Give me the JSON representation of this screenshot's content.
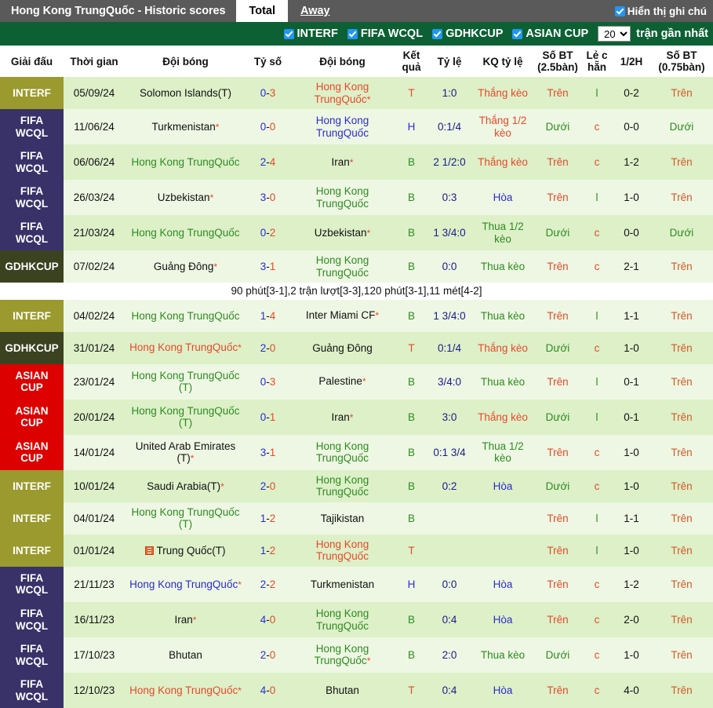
{
  "topbar": {
    "title": "Hong Kong TrungQuốc - Historic scores",
    "tab_total": "Total",
    "tab_away": "Away",
    "show_notes_label": "Hiển thị ghi chú"
  },
  "filterbar": {
    "filters": [
      {
        "label": "INTERF",
        "checked": true
      },
      {
        "label": "FIFA WCQL",
        "checked": true
      },
      {
        "label": "GDHKCUP",
        "checked": true
      },
      {
        "label": "ASIAN CUP",
        "checked": true
      }
    ],
    "count_value": "20",
    "count_options": [
      "10",
      "20",
      "30",
      "50"
    ],
    "tail_label": "trận gần nhất"
  },
  "table": {
    "headers": [
      "Giải đấu",
      "Thời gian",
      "Đội bóng",
      "Tỷ số",
      "Đội bóng",
      "Kết quả",
      "Tỷ lệ",
      "KQ tỷ lệ",
      "Số BT (2.5bàn)",
      "Lẻ c hẵn",
      "1/2H",
      "Số BT (0.75bàn)"
    ],
    "league_colors": {
      "INTERF": "#9a9a2e",
      "FIFA WCQL": "#383269",
      "GDHKCUP": "#3b4220",
      "ASIAN CUP": "#dd0000"
    },
    "rows": [
      {
        "league": "INTERF",
        "time": "05/09/24",
        "home": "Solomon Islands(T)",
        "home_color": "#111111",
        "home_star": false,
        "score": "0-3",
        "score_home": "0",
        "score_away": "3",
        "away": "Hong Kong TrungQuốc",
        "away_color": "#e8492b",
        "away_star": true,
        "result": "T",
        "result_color": "#e8492b",
        "odds": "1:0",
        "odds_result": "Thắng kèo",
        "odds_result_color": "#e8492b",
        "ou": "Trên",
        "ou_color": "#e8492b",
        "oe": "l",
        "oe_color": "#2e8b22",
        "ht": "0-2",
        "ou2": "Trên",
        "ou2_color": "#d4592a",
        "note": null
      },
      {
        "league": "FIFA WCQL",
        "time": "11/06/24",
        "home": "Turkmenistan",
        "home_color": "#111111",
        "home_star": true,
        "score": "0-0",
        "score_home": "0",
        "score_away": "0",
        "away": "Hong Kong TrungQuốc",
        "away_color": "#2b2bd4",
        "away_star": false,
        "result": "H",
        "result_color": "#2b2bd4",
        "odds": "0:1/4",
        "odds_result": "Thắng 1/2 kèo",
        "odds_result_color": "#e8492b",
        "ou": "Dưới",
        "ou_color": "#2e8b22",
        "oe": "c",
        "oe_color": "#e8492b",
        "ht": "0-0",
        "ou2": "Dưới",
        "ou2_color": "#2e8b22",
        "note": null
      },
      {
        "league": "FIFA WCQL",
        "time": "06/06/24",
        "home": "Hong Kong TrungQuốc",
        "home_color": "#2e8b22",
        "home_star": false,
        "score": "2-4",
        "score_home": "2",
        "score_away": "4",
        "away": "Iran",
        "away_color": "#111111",
        "away_star": true,
        "result": "B",
        "result_color": "#2e8b22",
        "odds": "2 1/2:0",
        "odds_result": "Thắng kèo",
        "odds_result_color": "#e8492b",
        "ou": "Trên",
        "ou_color": "#e8492b",
        "oe": "c",
        "oe_color": "#e8492b",
        "ht": "1-2",
        "ou2": "Trên",
        "ou2_color": "#d4592a",
        "note": null
      },
      {
        "league": "FIFA WCQL",
        "time": "26/03/24",
        "home": "Uzbekistan",
        "home_color": "#111111",
        "home_star": true,
        "score": "3-0",
        "score_home": "3",
        "score_away": "0",
        "away": "Hong Kong TrungQuốc",
        "away_color": "#2e8b22",
        "away_star": false,
        "result": "B",
        "result_color": "#2e8b22",
        "odds": "0:3",
        "odds_result": "Hòa",
        "odds_result_color": "#2b2bd4",
        "ou": "Trên",
        "ou_color": "#e8492b",
        "oe": "l",
        "oe_color": "#2e8b22",
        "ht": "1-0",
        "ou2": "Trên",
        "ou2_color": "#d4592a",
        "note": null
      },
      {
        "league": "FIFA WCQL",
        "time": "21/03/24",
        "home": "Hong Kong TrungQuốc",
        "home_color": "#2e8b22",
        "home_star": false,
        "score": "0-2",
        "score_home": "0",
        "score_away": "2",
        "away": "Uzbekistan",
        "away_color": "#111111",
        "away_star": true,
        "result": "B",
        "result_color": "#2e8b22",
        "odds": "1 3/4:0",
        "odds_result": "Thua 1/2 kèo",
        "odds_result_color": "#2e8b22",
        "ou": "Dưới",
        "ou_color": "#2e8b22",
        "oe": "c",
        "oe_color": "#e8492b",
        "ht": "0-0",
        "ou2": "Dưới",
        "ou2_color": "#2e8b22",
        "note": null
      },
      {
        "league": "GDHKCUP",
        "time": "07/02/24",
        "home": "Guảng Đông",
        "home_color": "#111111",
        "home_star": true,
        "score": "3-1",
        "score_home": "3",
        "score_away": "1",
        "away": "Hong Kong TrungQuốc",
        "away_color": "#2e8b22",
        "away_star": false,
        "result": "B",
        "result_color": "#2e8b22",
        "odds": "0:0",
        "odds_result": "Thua kèo",
        "odds_result_color": "#2e8b22",
        "ou": "Trên",
        "ou_color": "#e8492b",
        "oe": "c",
        "oe_color": "#e8492b",
        "ht": "2-1",
        "ou2": "Trên",
        "ou2_color": "#d4592a",
        "note": "90 phút[3-1],2 trận lượt[3-3],120 phút[3-1],11 mét[4-2]"
      },
      {
        "league": "INTERF",
        "time": "04/02/24",
        "home": "Hong Kong TrungQuốc",
        "home_color": "#2e8b22",
        "home_star": false,
        "score": "1-4",
        "score_home": "1",
        "score_away": "4",
        "away": "Inter Miami CF",
        "away_color": "#111111",
        "away_star": true,
        "result": "B",
        "result_color": "#2e8b22",
        "odds": "1 3/4:0",
        "odds_result": "Thua kèo",
        "odds_result_color": "#2e8b22",
        "ou": "Trên",
        "ou_color": "#e8492b",
        "oe": "l",
        "oe_color": "#2e8b22",
        "ht": "1-1",
        "ou2": "Trên",
        "ou2_color": "#d4592a",
        "note": null
      },
      {
        "league": "GDHKCUP",
        "time": "31/01/24",
        "home": "Hong Kong TrungQuốc",
        "home_color": "#e8492b",
        "home_star": true,
        "score": "2-0",
        "score_home": "2",
        "score_away": "0",
        "away": "Guảng Đông",
        "away_color": "#111111",
        "away_star": false,
        "result": "T",
        "result_color": "#e8492b",
        "odds": "0:1/4",
        "odds_result": "Thắng kèo",
        "odds_result_color": "#e8492b",
        "ou": "Dưới",
        "ou_color": "#2e8b22",
        "oe": "c",
        "oe_color": "#e8492b",
        "ht": "1-0",
        "ou2": "Trên",
        "ou2_color": "#d4592a",
        "note": null
      },
      {
        "league": "ASIAN CUP",
        "time": "23/01/24",
        "home": "Hong Kong TrungQuốc (T)",
        "home_color": "#2e8b22",
        "home_star": false,
        "score": "0-3",
        "score_home": "0",
        "score_away": "3",
        "away": "Palestine",
        "away_color": "#111111",
        "away_star": true,
        "result": "B",
        "result_color": "#2e8b22",
        "odds": "3/4:0",
        "odds_result": "Thua kèo",
        "odds_result_color": "#2e8b22",
        "ou": "Trên",
        "ou_color": "#e8492b",
        "oe": "l",
        "oe_color": "#2e8b22",
        "ht": "0-1",
        "ou2": "Trên",
        "ou2_color": "#d4592a",
        "note": null
      },
      {
        "league": "ASIAN CUP",
        "time": "20/01/24",
        "home": "Hong Kong TrungQuốc (T)",
        "home_color": "#2e8b22",
        "home_star": false,
        "score": "0-1",
        "score_home": "0",
        "score_away": "1",
        "away": "Iran",
        "away_color": "#111111",
        "away_star": true,
        "result": "B",
        "result_color": "#2e8b22",
        "odds": "3:0",
        "odds_result": "Thắng kèo",
        "odds_result_color": "#e8492b",
        "ou": "Dưới",
        "ou_color": "#2e8b22",
        "oe": "l",
        "oe_color": "#2e8b22",
        "ht": "0-1",
        "ou2": "Trên",
        "ou2_color": "#d4592a",
        "note": null
      },
      {
        "league": "ASIAN CUP",
        "time": "14/01/24",
        "home": "United Arab Emirates (T)",
        "home_color": "#111111",
        "home_star": true,
        "score": "3-1",
        "score_home": "3",
        "score_away": "1",
        "away": "Hong Kong TrungQuốc",
        "away_color": "#2e8b22",
        "away_star": false,
        "result": "B",
        "result_color": "#2e8b22",
        "odds": "0:1 3/4",
        "odds_result": "Thua 1/2 kèo",
        "odds_result_color": "#2e8b22",
        "ou": "Trên",
        "ou_color": "#e8492b",
        "oe": "c",
        "oe_color": "#e8492b",
        "ht": "1-0",
        "ou2": "Trên",
        "ou2_color": "#d4592a",
        "note": null
      },
      {
        "league": "INTERF",
        "time": "10/01/24",
        "home": "Saudi Arabia(T)",
        "home_color": "#111111",
        "home_star": true,
        "score": "2-0",
        "score_home": "2",
        "score_away": "0",
        "away": "Hong Kong TrungQuốc",
        "away_color": "#2e8b22",
        "away_star": false,
        "result": "B",
        "result_color": "#2e8b22",
        "odds": "0:2",
        "odds_result": "Hòa",
        "odds_result_color": "#2b2bd4",
        "ou": "Dưới",
        "ou_color": "#2e8b22",
        "oe": "c",
        "oe_color": "#e8492b",
        "ht": "1-0",
        "ou2": "Trên",
        "ou2_color": "#d4592a",
        "note": null
      },
      {
        "league": "INTERF",
        "time": "04/01/24",
        "home": "Hong Kong TrungQuốc (T)",
        "home_color": "#2e8b22",
        "home_star": false,
        "score": "1-2",
        "score_home": "1",
        "score_away": "2",
        "away": "Tajikistan",
        "away_color": "#111111",
        "away_star": false,
        "result": "B",
        "result_color": "#2e8b22",
        "odds": "",
        "odds_result": "",
        "odds_result_color": "#111111",
        "ou": "Trên",
        "ou_color": "#e8492b",
        "oe": "l",
        "oe_color": "#2e8b22",
        "ht": "1-1",
        "ou2": "Trên",
        "ou2_color": "#d4592a",
        "note": null
      },
      {
        "league": "INTERF",
        "time": "01/01/24",
        "home": "Trung Quốc(T)",
        "home_color": "#111111",
        "home_star": false,
        "home_flag": true,
        "score": "1-2",
        "score_home": "1",
        "score_away": "2",
        "away": "Hong Kong TrungQuốc",
        "away_color": "#e8492b",
        "away_star": false,
        "result": "T",
        "result_color": "#e8492b",
        "odds": "",
        "odds_result": "",
        "odds_result_color": "#111111",
        "ou": "Trên",
        "ou_color": "#e8492b",
        "oe": "l",
        "oe_color": "#2e8b22",
        "ht": "1-0",
        "ou2": "Trên",
        "ou2_color": "#d4592a",
        "note": null
      },
      {
        "league": "FIFA WCQL",
        "time": "21/11/23",
        "home": "Hong Kong TrungQuốc",
        "home_color": "#2b2bd4",
        "home_star": true,
        "score": "2-2",
        "score_home": "2",
        "score_away": "2",
        "away": "Turkmenistan",
        "away_color": "#111111",
        "away_star": false,
        "result": "H",
        "result_color": "#2b2bd4",
        "odds": "0:0",
        "odds_result": "Hòa",
        "odds_result_color": "#2b2bd4",
        "ou": "Trên",
        "ou_color": "#e8492b",
        "oe": "c",
        "oe_color": "#e8492b",
        "ht": "1-2",
        "ou2": "Trên",
        "ou2_color": "#d4592a",
        "note": null
      },
      {
        "league": "FIFA WCQL",
        "time": "16/11/23",
        "home": "Iran",
        "home_color": "#111111",
        "home_star": true,
        "score": "4-0",
        "score_home": "4",
        "score_away": "0",
        "away": "Hong Kong TrungQuốc",
        "away_color": "#2e8b22",
        "away_star": false,
        "result": "B",
        "result_color": "#2e8b22",
        "odds": "0:4",
        "odds_result": "Hòa",
        "odds_result_color": "#2b2bd4",
        "ou": "Trên",
        "ou_color": "#e8492b",
        "oe": "c",
        "oe_color": "#e8492b",
        "ht": "2-0",
        "ou2": "Trên",
        "ou2_color": "#d4592a",
        "note": null
      },
      {
        "league": "FIFA WCQL",
        "time": "17/10/23",
        "home": "Bhutan",
        "home_color": "#111111",
        "home_star": false,
        "score": "2-0",
        "score_home": "2",
        "score_away": "0",
        "away": "Hong Kong TrungQuốc",
        "away_color": "#2e8b22",
        "away_star": true,
        "result": "B",
        "result_color": "#2e8b22",
        "odds": "2:0",
        "odds_result": "Thua kèo",
        "odds_result_color": "#2e8b22",
        "ou": "Dưới",
        "ou_color": "#2e8b22",
        "oe": "c",
        "oe_color": "#e8492b",
        "ht": "1-0",
        "ou2": "Trên",
        "ou2_color": "#d4592a",
        "note": null
      },
      {
        "league": "FIFA WCQL",
        "time": "12/10/23",
        "home": "Hong Kong TrungQuốc",
        "home_color": "#e8492b",
        "home_star": true,
        "score": "4-0",
        "score_home": "4",
        "score_away": "0",
        "away": "Bhutan",
        "away_color": "#111111",
        "away_star": false,
        "result": "T",
        "result_color": "#e8492b",
        "odds": "0:4",
        "odds_result": "Hòa",
        "odds_result_color": "#2b2bd4",
        "ou": "Trên",
        "ou_color": "#e8492b",
        "oe": "c",
        "oe_color": "#e8492b",
        "ht": "4-0",
        "ou2": "Trên",
        "ou2_color": "#d4592a",
        "note": null
      }
    ]
  }
}
